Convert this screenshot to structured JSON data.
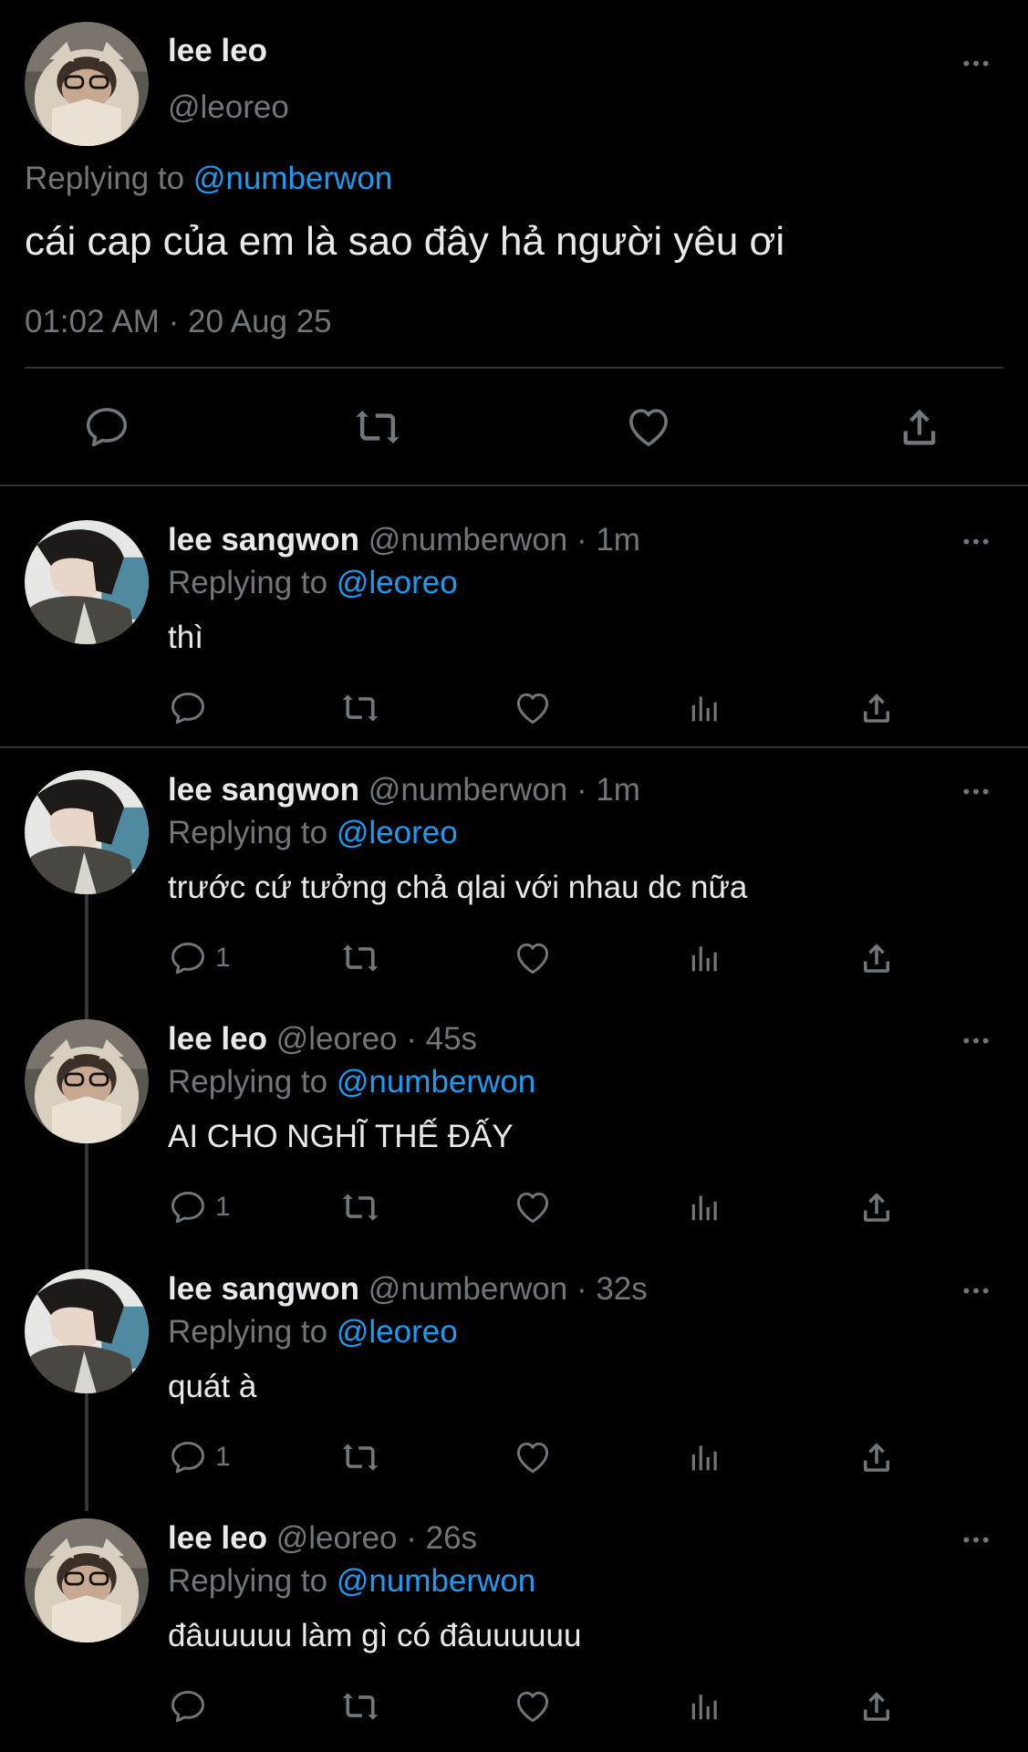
{
  "main": {
    "author_name": "lee leo",
    "author_handle": "@leoreo",
    "replying_label": "Replying to",
    "replying_handle": "@numberwon",
    "text": "cái cap của em là sao đây hả người yêu ơi",
    "timestamp": "01:02 AM · 20 Aug 25"
  },
  "replies": [
    {
      "name": "lee sangwon",
      "handle": "@numberwon",
      "time": "· 1m",
      "replying_label": "Replying to",
      "replying_handle": "@leoreo",
      "text": "thì",
      "reply_count": ""
    },
    {
      "name": "lee sangwon",
      "handle": "@numberwon",
      "time": "· 1m",
      "replying_label": "Replying to",
      "replying_handle": "@leoreo",
      "text": "trước cứ tưởng chả qlai với nhau dc nữa",
      "reply_count": "1"
    },
    {
      "name": "lee leo",
      "handle": "@leoreo",
      "time": "· 45s",
      "replying_label": "Replying to",
      "replying_handle": "@numberwon",
      "text": "AI CHO NGHĨ THẾ ĐẤY",
      "reply_count": "1"
    },
    {
      "name": "lee sangwon",
      "handle": "@numberwon",
      "time": "· 32s",
      "replying_label": "Replying to",
      "replying_handle": "@leoreo",
      "text": "quát à",
      "reply_count": "1"
    },
    {
      "name": "lee leo",
      "handle": "@leoreo",
      "time": "· 26s",
      "replying_label": "Replying to",
      "replying_handle": "@numberwon",
      "text": "đâuuuuu làm gì có đâuuuuuu",
      "reply_count": ""
    }
  ],
  "icons": {
    "reply": "speech-bubble-icon",
    "retweet": "retweet-arrows-icon",
    "like": "heart-icon",
    "views": "bar-chart-icon",
    "share": "share-upload-icon",
    "more": "ellipsis-icon"
  },
  "colors": {
    "background": "#000000",
    "text": "#e7e9ea",
    "muted": "#71767b",
    "link": "#1d9bf0",
    "divider": "#2f3336"
  }
}
